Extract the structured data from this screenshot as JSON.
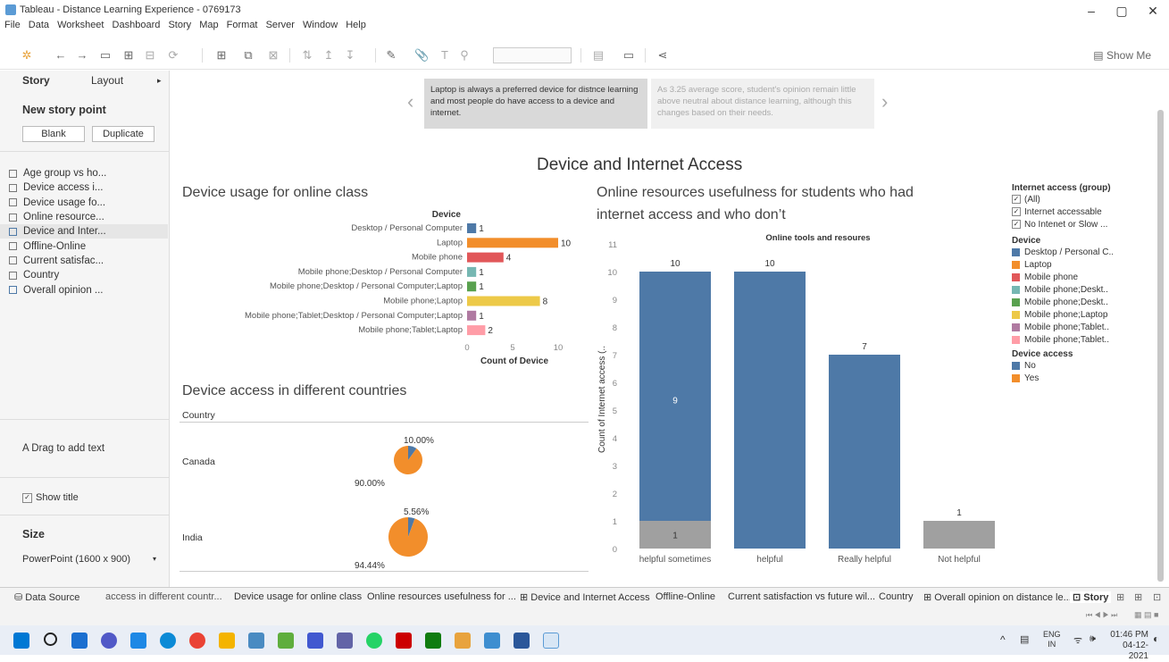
{
  "window": {
    "title": "Tableau - Distance Learning Experience - 0769173"
  },
  "menu": [
    "File",
    "Data",
    "Worksheet",
    "Dashboard",
    "Story",
    "Map",
    "Format",
    "Server",
    "Window",
    "Help"
  ],
  "toolbar": {
    "show_me": "Show Me"
  },
  "sidebar": {
    "tabs": {
      "story": "Story",
      "layout": "Layout"
    },
    "new_story_point": "New story point",
    "blank": "Blank",
    "duplicate": "Duplicate",
    "story_points": [
      "Age group vs ho...",
      "Device access i...",
      "Device usage fo...",
      "Online resource...",
      "Device and Inter...",
      "Offline-Online",
      "Current satisfac...",
      "Country",
      "Overall opinion ..."
    ],
    "drag_text": "A  Drag to add text",
    "show_title": "Show title",
    "size_label": "Size",
    "size_value": "PowerPoint (1600 x 900)"
  },
  "nav": {
    "caption_left": "Laptop  is always a preferred device for distnce learning and most people do have access to a device and internet.",
    "caption_right": "As 3.25 average score, student's opinion remain little above neutral about distance learning, although this changes based  on their needs."
  },
  "dashboard_title": "Device and Internet Access",
  "device_usage": {
    "title": "Device usage for online class",
    "header": "Device",
    "x_title": "Count of Device"
  },
  "device_access": {
    "title": "Device access in different countries",
    "header": "Country",
    "rows": [
      {
        "country": "Canada",
        "no_label": "10.00%",
        "yes_label": "90.00%"
      },
      {
        "country": "India",
        "no_label": "5.56%",
        "yes_label": "94.44%"
      }
    ]
  },
  "online_resources": {
    "title_line1": "Online resources usefulness for students who had",
    "title_line2": "internet access and who don’t",
    "chart_title": "Online tools and resoures",
    "y_title": "Count of Internet access (..",
    "gray_label": "1"
  },
  "legends": {
    "internet_title": "Internet access (group)",
    "internet_items": [
      "(All)",
      "Internet accessable",
      "No Intenet or Slow ..."
    ],
    "device_title": "Device",
    "device_items": [
      "Desktop / Personal C..",
      "Laptop",
      "Mobile phone",
      "Mobile phone;Deskt..",
      "Mobile phone;Deskt..",
      "Mobile phone;Laptop",
      "Mobile phone;Tablet..",
      "Mobile phone;Tablet.."
    ],
    "access_title": "Device access",
    "access_items": [
      "No",
      "Yes"
    ]
  },
  "colors": {
    "blue": "#4e79a7",
    "orange": "#f28e2b",
    "red": "#e15759",
    "teal": "#76b7b2",
    "green": "#59a14f",
    "yellow": "#edc948",
    "purple": "#b07aa1",
    "pink": "#ff9da7",
    "gray": "#a0a0a0"
  },
  "bottom_tabs": [
    "Data Source",
    "access in different countr...",
    "Device usage for online class",
    "Online resources usefulness for ...",
    "Device and Internet Access",
    "Offline-Online",
    "Current satisfaction vs future wil...",
    "Country",
    "Overall opinion on distance le...",
    "Story"
  ],
  "taskbar": {
    "lang1": "ENG",
    "lang2": "IN",
    "time": "01:46 PM",
    "date": "04-12-2021"
  },
  "chart_data": [
    {
      "type": "bar",
      "title": "Device usage for online class",
      "orientation": "horizontal",
      "categories": [
        "Desktop / Personal Computer",
        "Laptop",
        "Mobile phone",
        "Mobile phone;Desktop / Personal Computer",
        "Mobile phone;Desktop / Personal Computer;Laptop",
        "Mobile phone;Laptop",
        "Mobile phone;Tablet;Desktop / Personal Computer;Laptop",
        "Mobile phone;Tablet;Laptop"
      ],
      "values": [
        1,
        10,
        4,
        1,
        1,
        8,
        1,
        2
      ],
      "colors": [
        "#4e79a7",
        "#f28e2b",
        "#e15759",
        "#76b7b2",
        "#59a14f",
        "#edc948",
        "#b07aa1",
        "#ff9da7"
      ],
      "xlabel": "Count of Device",
      "ylabel": "Device",
      "xticks": [
        0,
        5,
        10
      ]
    },
    {
      "type": "pie",
      "title": "Device access in different countries",
      "pies": [
        {
          "name": "Canada",
          "slices": [
            {
              "label": "No",
              "value": 10.0
            },
            {
              "label": "Yes",
              "value": 90.0
            }
          ]
        },
        {
          "name": "India",
          "slices": [
            {
              "label": "No",
              "value": 5.56
            },
            {
              "label": "Yes",
              "value": 94.44
            }
          ]
        }
      ]
    },
    {
      "type": "bar",
      "title": "Online tools and resoures",
      "categories": [
        "helpful sometimes",
        "helpful",
        "Really helpful",
        "Not helpful"
      ],
      "series": [
        {
          "name": "Internet accessable",
          "values": [
            9,
            10,
            7,
            0
          ]
        },
        {
          "name": "No Intenet or Slow ...",
          "values": [
            1,
            0,
            0,
            1
          ]
        }
      ],
      "totals": [
        10,
        10,
        7,
        1
      ],
      "ylabel": "Count of Internet access (..",
      "ylim": [
        0,
        11
      ],
      "yticks": [
        0,
        1,
        2,
        3,
        4,
        5,
        6,
        7,
        8,
        9,
        10,
        11
      ]
    }
  ]
}
